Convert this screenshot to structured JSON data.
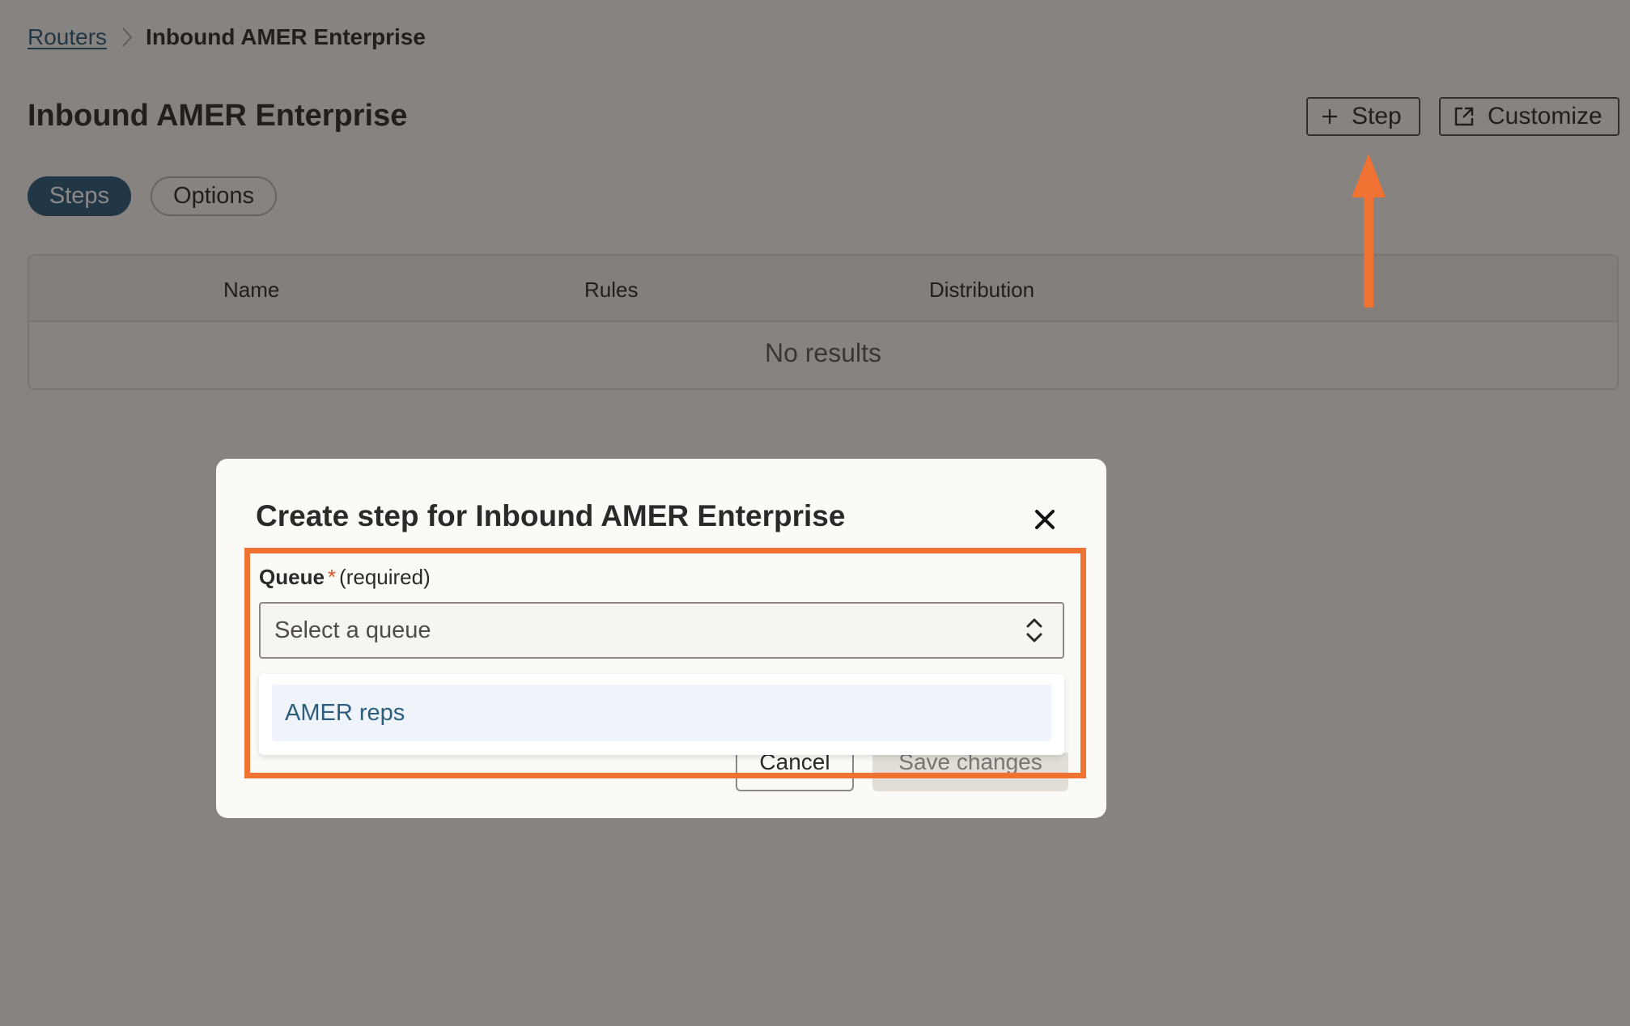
{
  "breadcrumb": {
    "root_label": "Routers",
    "current_label": "Inbound AMER Enterprise"
  },
  "page": {
    "title": "Inbound AMER Enterprise"
  },
  "header_actions": {
    "step_label": "Step",
    "customize_label": "Customize"
  },
  "tabs": [
    {
      "label": "Steps",
      "active": true
    },
    {
      "label": "Options",
      "active": false
    }
  ],
  "table": {
    "columns": [
      "Name",
      "Rules",
      "Distribution"
    ],
    "empty_text": "No results"
  },
  "modal": {
    "title": "Create step for Inbound AMER Enterprise",
    "queue_field": {
      "label": "Queue",
      "required_marker": "*",
      "required_text": "(required)",
      "placeholder": "Select a queue",
      "options": [
        "AMER reps"
      ]
    },
    "cancel_label": "Cancel",
    "save_label": "Save changes"
  },
  "icons": {
    "breadcrumb_separator": "chevron-right-icon",
    "step_button": "plus-icon",
    "customize_button": "external-link-icon",
    "close": "close-icon",
    "select": "chevron-up-down-icon"
  },
  "colors": {
    "primary": "#2c5d7c",
    "annotation": "#ef7232",
    "required": "#d9542b",
    "overlay": "rgba(24,18,16,0.50)"
  }
}
